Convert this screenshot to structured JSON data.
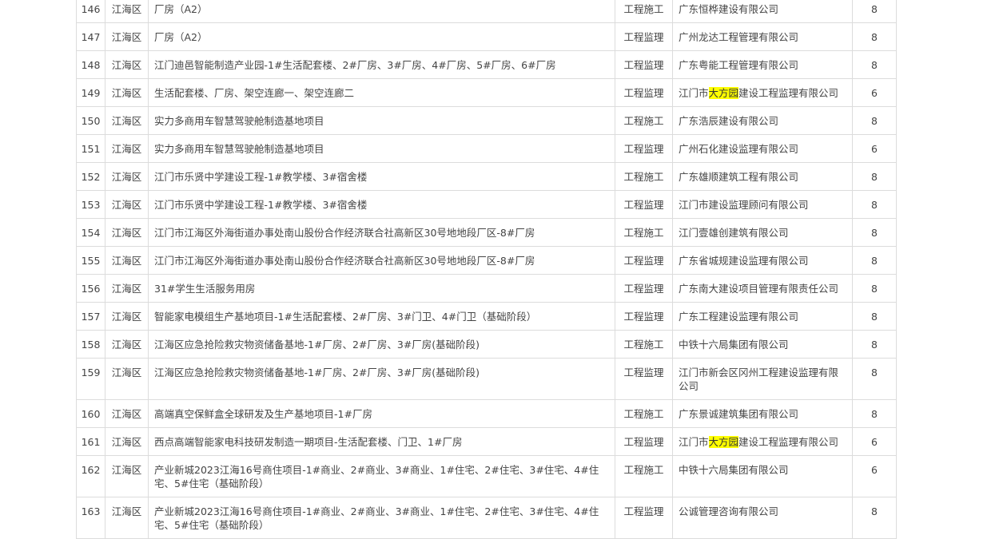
{
  "rows": [
    {
      "no": "146",
      "district": "江海区",
      "project": "厂房（A2）",
      "type": "工程施工",
      "company": [
        "广东恒桦建设有限公司"
      ],
      "score": "8"
    },
    {
      "no": "147",
      "district": "江海区",
      "project": "厂房（A2）",
      "type": "工程监理",
      "company": [
        "广州龙达工程管理有限公司"
      ],
      "score": "8"
    },
    {
      "no": "148",
      "district": "江海区",
      "project": "江门迪邑智能制造产业园-1#生活配套楼、2#厂房、3#厂房、4#厂房、5#厂房、6#厂房",
      "type": "工程监理",
      "company": [
        "广东粤能工程管理有限公司"
      ],
      "score": "8"
    },
    {
      "no": "149",
      "district": "江海区",
      "project": "生活配套楼、厂房、架空连廊一、架空连廊二",
      "type": "工程监理",
      "company": [
        "江门市",
        "大方园",
        "建设工程监理有限公司"
      ],
      "score": "6"
    },
    {
      "no": "150",
      "district": "江海区",
      "project": "实力多商用车智慧驾驶舱制造基地项目",
      "type": "工程施工",
      "company": [
        "广东浩辰建设有限公司"
      ],
      "score": "8"
    },
    {
      "no": "151",
      "district": "江海区",
      "project": "实力多商用车智慧驾驶舱制造基地项目",
      "type": "工程监理",
      "company": [
        "广州石化建设监理有限公司"
      ],
      "score": "6"
    },
    {
      "no": "152",
      "district": "江海区",
      "project": "江门市乐贤中学建设工程-1#教学楼、3#宿舍楼",
      "type": "工程施工",
      "company": [
        "广东雄顺建筑工程有限公司"
      ],
      "score": "8"
    },
    {
      "no": "153",
      "district": "江海区",
      "project": "江门市乐贤中学建设工程-1#教学楼、3#宿舍楼",
      "type": "工程监理",
      "company": [
        "江门市建设监理顾问有限公司"
      ],
      "score": "8"
    },
    {
      "no": "154",
      "district": "江海区",
      "project": "江门市江海区外海街道办事处南山股份合作经济联合社高新区30号地地段厂区-8#厂房",
      "type": "工程施工",
      "company": [
        "江门壹雄创建筑有限公司"
      ],
      "score": "8"
    },
    {
      "no": "155",
      "district": "江海区",
      "project": "江门市江海区外海街道办事处南山股份合作经济联合社高新区30号地地段厂区-8#厂房",
      "type": "工程监理",
      "company": [
        "广东省城规建设监理有限公司"
      ],
      "score": "8"
    },
    {
      "no": "156",
      "district": "江海区",
      "project": "31#学生生活服务用房",
      "type": "工程监理",
      "company": [
        "广东南大建设项目管理有限责任公司"
      ],
      "score": "8"
    },
    {
      "no": "157",
      "district": "江海区",
      "project": "智能家电模组生产基地项目-1#生活配套楼、2#厂房、3#门卫、4#门卫（基础阶段）",
      "type": "工程监理",
      "company": [
        "广东工程建设监理有限公司"
      ],
      "score": "8"
    },
    {
      "no": "158",
      "district": "江海区",
      "project": "江海区应急抢险救灾物资储备基地-1#厂房、2#厂房、3#厂房(基础阶段)",
      "type": "工程施工",
      "company": [
        "中铁十六局集团有限公司"
      ],
      "score": "8"
    },
    {
      "no": "159",
      "district": "江海区",
      "project": "江海区应急抢险救灾物资储备基地-1#厂房、2#厂房、3#厂房(基础阶段)",
      "type": "工程监理",
      "company": [
        "江门市新会区冈州工程建设监理有限公司"
      ],
      "score": "8"
    },
    {
      "no": "160",
      "district": "江海区",
      "project": "高端真空保鲜盒全球研发及生产基地项目-1#厂房",
      "type": "工程施工",
      "company": [
        "广东景诚建筑集团有限公司"
      ],
      "score": "8"
    },
    {
      "no": "161",
      "district": "江海区",
      "project": "西点高端智能家电科技研发制造一期项目-生活配套楼、门卫、1#厂房",
      "type": "工程监理",
      "company": [
        "江门市",
        "大方园",
        "建设工程监理有限公司"
      ],
      "score": "6"
    },
    {
      "no": "162",
      "district": "江海区",
      "project": "产业新城2023江海16号商住项目-1#商业、2#商业、3#商业、1#住宅、2#住宅、3#住宅、4#住宅、5#住宅（基础阶段）",
      "type": "工程施工",
      "company": [
        "中铁十六局集团有限公司"
      ],
      "score": "6"
    },
    {
      "no": "163",
      "district": "江海区",
      "project": "产业新城2023江海16号商住项目-1#商业、2#商业、3#商业、1#住宅、2#住宅、3#住宅、4#住宅、5#住宅（基础阶段）",
      "type": "工程监理",
      "company": [
        "公诚管理咨询有限公司"
      ],
      "score": "8"
    }
  ],
  "highlight_color": "#ffff00"
}
